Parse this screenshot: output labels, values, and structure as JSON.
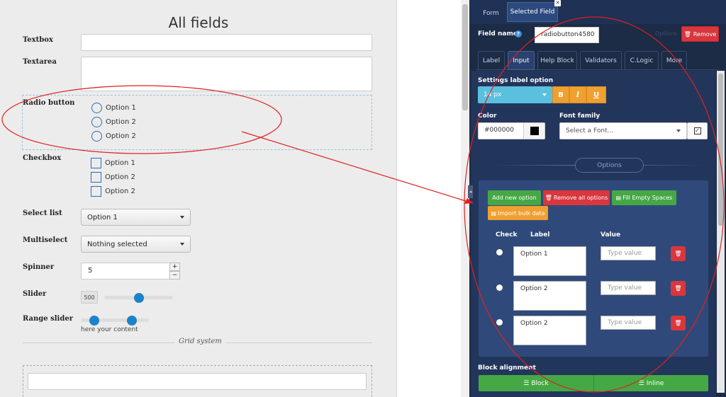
{
  "form": {
    "title": "All fields",
    "textbox_label": "Textbox",
    "textarea_label": "Textarea",
    "radio_label": "Radio button",
    "radio_options": [
      "Option 1",
      "Option 2",
      "Option 2"
    ],
    "checkbox_label": "Checkbox",
    "checkbox_options": [
      "Option 1",
      "Option 2",
      "Option 2"
    ],
    "select_label": "Select list",
    "select_value": "Option 1",
    "multiselect_label": "Multiselect",
    "multiselect_value": "Nothing selected",
    "spinner_label": "Spinner",
    "spinner_value": "5",
    "spinner_plus": "+",
    "spinner_minus": "−",
    "slider_label": "Slider",
    "slider_value": "500",
    "slider_level": 0.5,
    "range_label": "Range slider",
    "range_levels": [
      0.2,
      0.75
    ],
    "range_help": "here your content",
    "grid_title": "Grid system"
  },
  "panel": {
    "tabs": [
      "Form",
      "Selected Field"
    ],
    "field_name_label": "Field name",
    "field_name_value": "radiobutton4580",
    "options_hint": "Options",
    "remove_label": "Remove",
    "subtabs": [
      "Label",
      "Input",
      "Help Block",
      "Validators",
      "C.Logic",
      "More"
    ],
    "settings_label": "Settings label option",
    "font_size": "14 px",
    "bold": "B",
    "italic": "I",
    "underline": "U",
    "color_label": "Color",
    "color_value": "#000000",
    "swatch_color": "#000000",
    "font_family_label": "Font family",
    "font_family_placeholder": "Select a Font...",
    "options_title": "Options",
    "add_option": "Add new option",
    "remove_all": "Remove all options",
    "fill_empty": "Fill Empty Spaces",
    "import_bulk": "Import bulk data",
    "col_check": "Check",
    "col_label": "Label",
    "col_value": "Value",
    "rows": [
      {
        "label": "Option 1",
        "value_placeholder": "Type value"
      },
      {
        "label": "Option 2",
        "value_placeholder": "Type value"
      },
      {
        "label": "Option 2",
        "value_placeholder": "Type value"
      }
    ],
    "block_alignment": "Block alignment",
    "block_btn": "Block",
    "inline_btn": "Inline"
  },
  "colors": {
    "accent_blue": "#5bc0de",
    "orange": "#f0a030",
    "green": "#45a845",
    "red": "#d9363e",
    "annotation": "#e02020"
  },
  "icons": [
    "info-icon",
    "trash-icon",
    "fill-icon",
    "import-icon",
    "align-block-icon",
    "align-inline-icon",
    "check-icon",
    "chevron-down-icon",
    "close-icon"
  ]
}
